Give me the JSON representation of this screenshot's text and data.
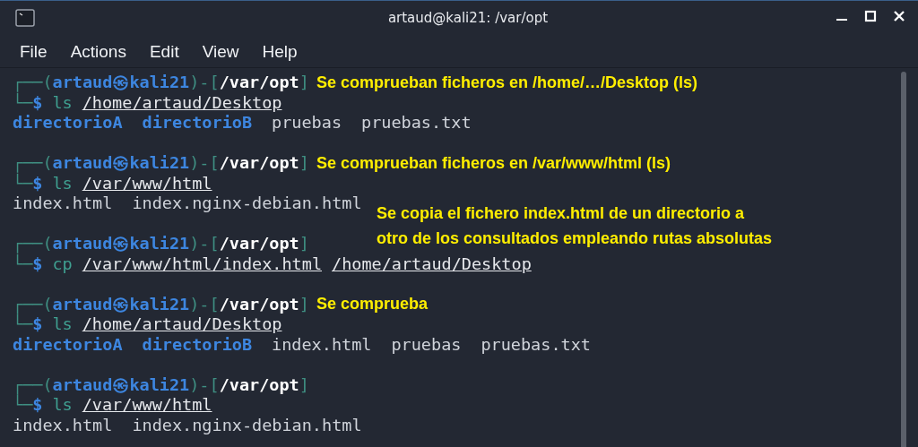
{
  "window": {
    "title": "artaud@kali21: /var/opt"
  },
  "menu": [
    "File",
    "Actions",
    "Edit",
    "View",
    "Help"
  ],
  "blocks": [
    {
      "prompt": {
        "open": "┌──(",
        "user_host": "artaud㉿kali21",
        "mid": ")-[",
        "path": "/var/opt",
        "close": "]",
        "corner": "└─",
        "dollar": "$"
      },
      "note": {
        "kind": "inline",
        "lines": [
          "Se comprueban ficheros en /home/…/Desktop (ls)"
        ]
      },
      "command": "ls",
      "args": [
        "/home/artaud/Desktop"
      ],
      "output": [
        {
          "name": "directorioA",
          "kind": "dir"
        },
        {
          "name": "directorioB",
          "kind": "dir"
        },
        {
          "name": "pruebas",
          "kind": "file"
        },
        {
          "name": "pruebas.txt",
          "kind": "file"
        }
      ]
    },
    {
      "prompt": {
        "open": "┌──(",
        "user_host": "artaud㉿kali21",
        "mid": ")-[",
        "path": "/var/opt",
        "close": "]",
        "corner": "└─",
        "dollar": "$"
      },
      "note": {
        "kind": "inline",
        "lines": [
          "Se comprueban ficheros en /var/www/html (ls)"
        ]
      },
      "command": "ls",
      "args": [
        "/var/www/html"
      ],
      "output": [
        {
          "name": "index.html",
          "kind": "file"
        },
        {
          "name": "index.nginx-debian.html",
          "kind": "file"
        }
      ]
    },
    {
      "prompt": {
        "open": "┌──(",
        "user_host": "artaud㉿kali21",
        "mid": ")-[",
        "path": "/var/opt",
        "close": "]",
        "corner": "└─",
        "dollar": "$"
      },
      "note": {
        "kind": "floating",
        "lines": [
          "Se copia el fichero index.html de un directorio a",
          "otro de los consultados empleando rutas absolutas"
        ]
      },
      "command": "cp",
      "args": [
        "/var/www/html/index.html",
        "/home/artaud/Desktop"
      ]
    },
    {
      "prompt": {
        "open": "┌──(",
        "user_host": "artaud㉿kali21",
        "mid": ")-[",
        "path": "/var/opt",
        "close": "]",
        "corner": "└─",
        "dollar": "$"
      },
      "note": {
        "kind": "inline",
        "lines": [
          "Se comprueba"
        ]
      },
      "command": "ls",
      "args": [
        "/home/artaud/Desktop"
      ],
      "output": [
        {
          "name": "directorioA",
          "kind": "dir"
        },
        {
          "name": "directorioB",
          "kind": "dir"
        },
        {
          "name": "index.html",
          "kind": "file"
        },
        {
          "name": "pruebas",
          "kind": "file"
        },
        {
          "name": "pruebas.txt",
          "kind": "file"
        }
      ]
    },
    {
      "prompt": {
        "open": "┌──(",
        "user_host": "artaud㉿kali21",
        "mid": ")-[",
        "path": "/var/opt",
        "close": "]",
        "corner": "└─",
        "dollar": "$"
      },
      "command": "ls",
      "args": [
        "/var/www/html"
      ],
      "output": [
        {
          "name": "index.html",
          "kind": "file"
        },
        {
          "name": "index.nginx-debian.html",
          "kind": "file"
        }
      ]
    }
  ]
}
